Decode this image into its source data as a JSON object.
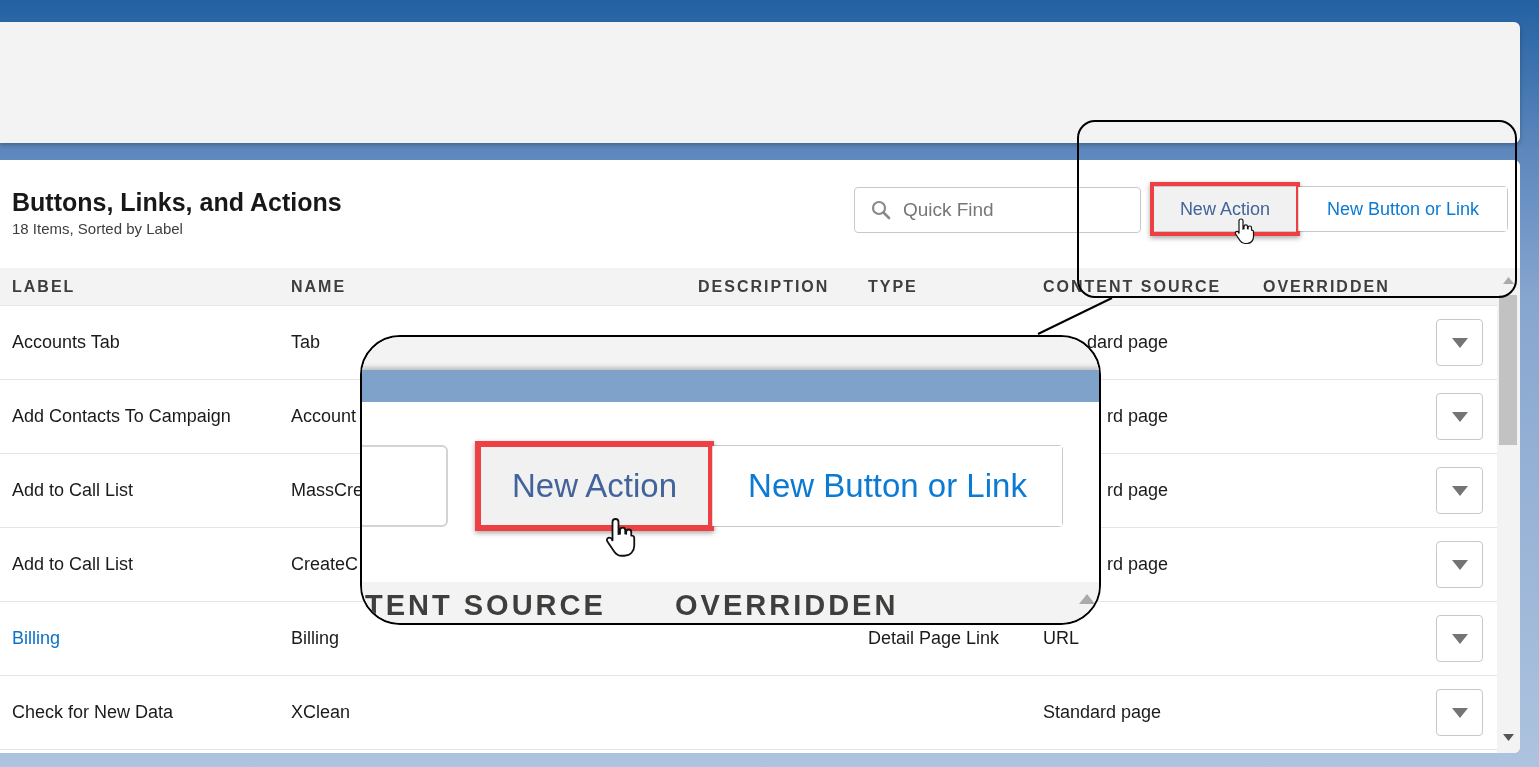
{
  "header": {
    "title": "Buttons, Links, and Actions",
    "subtitle": "18 Items, Sorted by Label"
  },
  "search": {
    "placeholder": "Quick Find"
  },
  "buttons": [
    {
      "label": "New Action",
      "highlighted": true
    },
    {
      "label": "New Button or Link",
      "highlighted": false
    }
  ],
  "table": {
    "columns": [
      "LABEL",
      "NAME",
      "DESCRIPTION",
      "TYPE",
      "CONTENT SOURCE",
      "OVERRIDDEN"
    ],
    "rows": [
      {
        "label": "Accounts Tab",
        "is_link": false,
        "name": "Tab",
        "type": "",
        "content_source": "dard page",
        "content_cut": true
      },
      {
        "label": "Add Contacts To Campaign",
        "is_link": false,
        "name": "Account",
        "type": "",
        "content_source": "rd page",
        "content_cut": true
      },
      {
        "label": "Add to Call List",
        "is_link": false,
        "name": "MassCre",
        "type": "",
        "content_source": "rd page",
        "content_cut": true
      },
      {
        "label": "Add to Call List",
        "is_link": false,
        "name": "CreateC",
        "type": "",
        "content_source": "rd page",
        "content_cut": true
      },
      {
        "label": "Billing",
        "is_link": true,
        "name": "Billing",
        "type": "Detail Page Link",
        "content_source": "URL",
        "content_cut": false
      },
      {
        "label": "Check for New Data",
        "is_link": false,
        "name": "XClean",
        "type": "",
        "content_source": "Standard page",
        "content_cut": false
      }
    ]
  },
  "magnifier": {
    "buttons": [
      {
        "label": "New Action",
        "highlighted": true
      },
      {
        "label": "New Button or Link",
        "highlighted": false
      }
    ],
    "columns": [
      "TENT SOURCE",
      "OVERRIDDEN"
    ]
  }
}
